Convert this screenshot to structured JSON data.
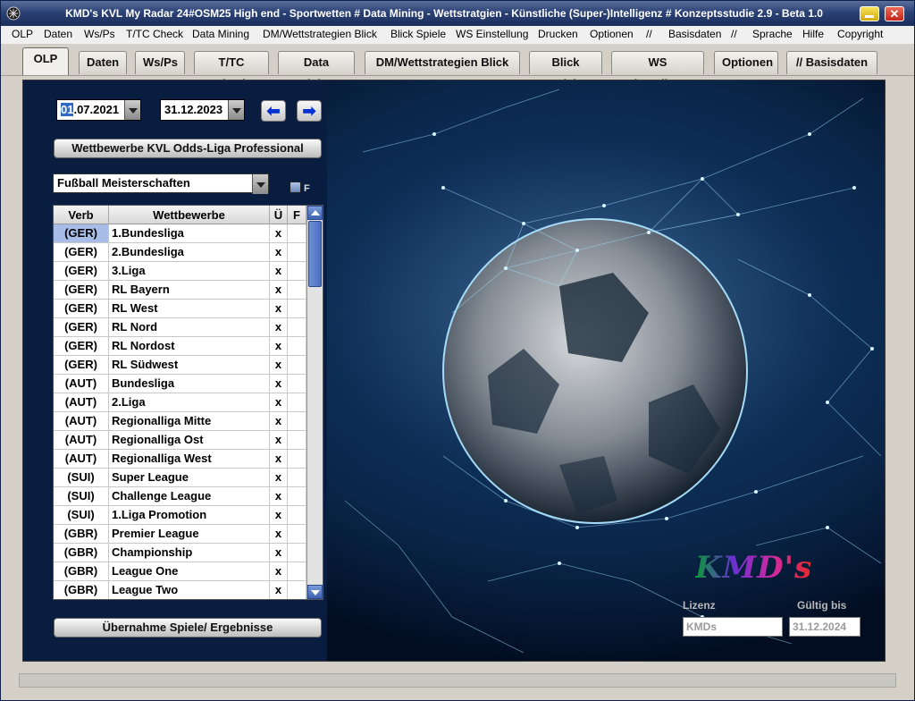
{
  "window": {
    "title": "KMD's KVL My Radar 24#OSM25 High end - Sportwetten # Data Mining - Wettstratgien - Künstliche (Super-)Intelligenz # Konzeptsstudie 2.9 - Beta 1.0",
    "close_label": "✕"
  },
  "menu": [
    "OLP",
    "Daten",
    "Ws/Ps",
    "T/TC Check",
    "Data Mining",
    "DM/Wettstrategien Blick",
    "Blick Spiele",
    "WS Einstellung",
    "Drucken",
    "Optionen",
    "//",
    "Basisdaten",
    "//",
    "Sprache",
    "Hilfe",
    "Copyright"
  ],
  "tabs": [
    "OLP",
    "Daten",
    "Ws/Ps",
    "T/TC Check",
    "Data Mining",
    "DM/Wettstrategien Blick",
    "Blick Spiele",
    "WS Einstellung",
    "Optionen",
    "// Basisdaten"
  ],
  "active_tab": "OLP",
  "dates": {
    "from_selected": "01",
    "from_rest": ".07.2021",
    "to": "31.12.2023"
  },
  "nav": {
    "prev": "⬅",
    "next": "➡"
  },
  "competitions_button": "Wettbewerbe KVL Odds-Liga Professional",
  "category_select": "Fußball Meisterschaften",
  "checkbox_label": "F",
  "grid": {
    "headers": {
      "verb": "Verb",
      "name": "Wettbewerbe",
      "u": "Ü",
      "f": "F"
    },
    "rows": [
      {
        "verb": "(GER)",
        "name": "1.Bundesliga",
        "u": "x",
        "f": ""
      },
      {
        "verb": "(GER)",
        "name": "2.Bundesliga",
        "u": "x",
        "f": ""
      },
      {
        "verb": "(GER)",
        "name": "3.Liga",
        "u": "x",
        "f": ""
      },
      {
        "verb": "(GER)",
        "name": "RL Bayern",
        "u": "x",
        "f": ""
      },
      {
        "verb": "(GER)",
        "name": "RL West",
        "u": "x",
        "f": ""
      },
      {
        "verb": "(GER)",
        "name": "RL Nord",
        "u": "x",
        "f": ""
      },
      {
        "verb": "(GER)",
        "name": "RL Nordost",
        "u": "x",
        "f": ""
      },
      {
        "verb": "(GER)",
        "name": "RL Südwest",
        "u": "x",
        "f": ""
      },
      {
        "verb": "(AUT)",
        "name": "Bundesliga",
        "u": "x",
        "f": ""
      },
      {
        "verb": "(AUT)",
        "name": "2.Liga",
        "u": "x",
        "f": ""
      },
      {
        "verb": "(AUT)",
        "name": "Regionalliga Mitte",
        "u": "x",
        "f": ""
      },
      {
        "verb": "(AUT)",
        "name": "Regionalliga Ost",
        "u": "x",
        "f": ""
      },
      {
        "verb": "(AUT)",
        "name": "Regionalliga West",
        "u": "x",
        "f": ""
      },
      {
        "verb": "(SUI)",
        "name": "Super League",
        "u": "x",
        "f": ""
      },
      {
        "verb": "(SUI)",
        "name": "Challenge League",
        "u": "x",
        "f": ""
      },
      {
        "verb": "(SUI)",
        "name": "1.Liga Promotion",
        "u": "x",
        "f": ""
      },
      {
        "verb": "(GBR)",
        "name": "Premier League",
        "u": "x",
        "f": ""
      },
      {
        "verb": "(GBR)",
        "name": "Championship",
        "u": "x",
        "f": ""
      },
      {
        "verb": "(GBR)",
        "name": "League One",
        "u": "x",
        "f": ""
      },
      {
        "verb": "(GBR)",
        "name": "League Two",
        "u": "x",
        "f": ""
      }
    ]
  },
  "import_button": "Übernahme Spiele/ Ergebnisse",
  "logo_text": "KMD's",
  "license": {
    "label": "Lizenz",
    "value": "KMDs",
    "valid_label": "Gültig bis",
    "valid_value": "31.12.2024"
  },
  "colors": {
    "titlebar": "#1b2f5c",
    "selection": "#316ac5",
    "background": "#041a3a"
  }
}
